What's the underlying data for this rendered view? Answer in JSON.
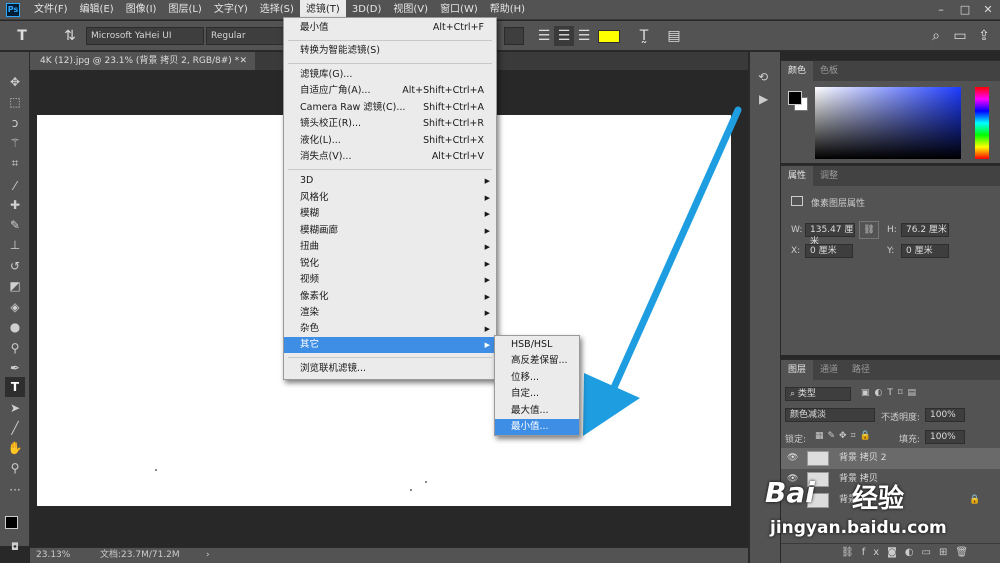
{
  "menubar": {
    "logo": "Ps",
    "items": [
      "文件(F)",
      "编辑(E)",
      "图像(I)",
      "图层(L)",
      "文字(Y)",
      "选择(S)",
      "滤镜(T)",
      "3D(D)",
      "视图(V)",
      "窗口(W)",
      "帮助(H)"
    ]
  },
  "options": {
    "font_family": "Microsoft YaHei UI",
    "font_style": "Regular"
  },
  "document": {
    "tab_title": "4K (12).jpg @ 23.1% (背景 拷贝 2, RGB/8#) *",
    "zoom": "23.13%",
    "doc_info": "文档:23.7M/71.2M"
  },
  "filter_menu": {
    "items": [
      {
        "label": "最小值",
        "shortcut": "Alt+Ctrl+F"
      },
      {
        "label": "转换为智能滤镜(S)",
        "shortcut": ""
      },
      {
        "label": "滤镜库(G)...",
        "shortcut": ""
      },
      {
        "label": "自适应广角(A)...",
        "shortcut": "Alt+Shift+Ctrl+A"
      },
      {
        "label": "Camera Raw 滤镜(C)...",
        "shortcut": "Shift+Ctrl+A"
      },
      {
        "label": "镜头校正(R)...",
        "shortcut": "Shift+Ctrl+R"
      },
      {
        "label": "液化(L)...",
        "shortcut": "Shift+Ctrl+X"
      },
      {
        "label": "消失点(V)...",
        "shortcut": "Alt+Ctrl+V"
      },
      {
        "label": "3D",
        "shortcut": ""
      },
      {
        "label": "风格化",
        "shortcut": ""
      },
      {
        "label": "模糊",
        "shortcut": ""
      },
      {
        "label": "模糊画廊",
        "shortcut": ""
      },
      {
        "label": "扭曲",
        "shortcut": ""
      },
      {
        "label": "锐化",
        "shortcut": ""
      },
      {
        "label": "视频",
        "shortcut": ""
      },
      {
        "label": "像素化",
        "shortcut": ""
      },
      {
        "label": "渲染",
        "shortcut": ""
      },
      {
        "label": "杂色",
        "shortcut": ""
      },
      {
        "label": "其它",
        "shortcut": ""
      },
      {
        "label": "浏览联机滤镜...",
        "shortcut": ""
      }
    ]
  },
  "other_submenu": {
    "items": [
      "HSB/HSL",
      "高反差保留...",
      "位移...",
      "自定...",
      "最大值...",
      "最小值..."
    ]
  },
  "color_panel": {
    "tabs": [
      "颜色",
      "色板"
    ]
  },
  "properties_panel": {
    "tabs": [
      "属性",
      "调整"
    ],
    "title": "像素图层属性",
    "w_label": "W:",
    "w_value": "135.47 厘米",
    "h_label": "H:",
    "h_value": "76.2 厘米",
    "x_label": "X:",
    "x_value": "0 厘米",
    "y_label": "Y:",
    "y_value": "0 厘米"
  },
  "layers_panel": {
    "tabs": [
      "图层",
      "通道",
      "路径"
    ],
    "filter_kind": "类型",
    "blend_mode": "颜色减淡",
    "opacity_label": "不透明度:",
    "opacity_value": "100%",
    "lock_label": "锁定:",
    "fill_label": "填充:",
    "fill_value": "100%",
    "layers": [
      "背景 拷贝 2",
      "背景 拷贝",
      "背景"
    ]
  },
  "watermark": {
    "brand": "Bai",
    "brand2": "经验",
    "url": "jingyan.baidu.com"
  },
  "colors": {
    "accent": "#3f8ee6",
    "arrow": "#1e9ee0",
    "swatch": "#ffff00"
  }
}
